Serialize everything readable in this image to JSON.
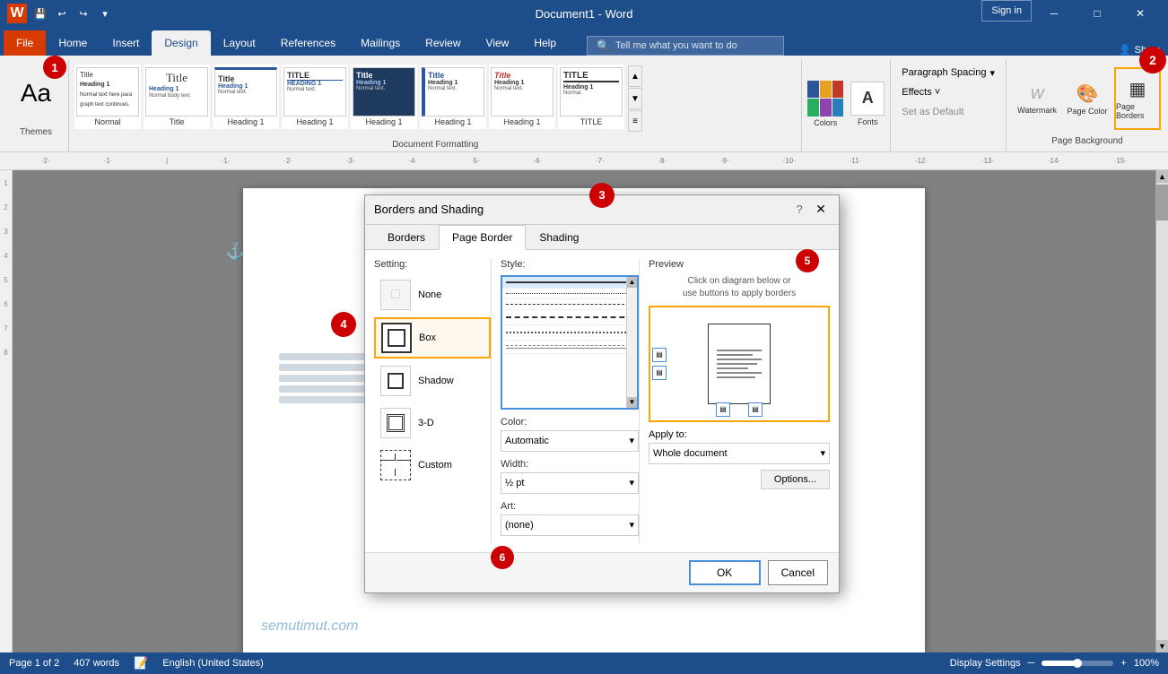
{
  "titlebar": {
    "title": "Document1 - Word",
    "save_label": "💾",
    "undo_label": "↩",
    "redo_label": "↪",
    "minimize": "─",
    "maximize": "□",
    "close": "✕",
    "signin": "Sign in"
  },
  "ribbon": {
    "tabs": [
      "File",
      "Home",
      "Insert",
      "Design",
      "Layout",
      "References",
      "Mailings",
      "Review",
      "View",
      "Help"
    ],
    "active_tab": "Design",
    "themes_label": "Themes",
    "colors_label": "Colors",
    "fonts_label": "Fonts",
    "paragraph_spacing_label": "Paragraph Spacing",
    "effects_label": "Effects ˅",
    "set_as_default_label": "Set as Default",
    "watermark_label": "Watermark",
    "page_color_label": "Page Color",
    "page_borders_label": "Page Borders",
    "page_background_label": "Page Background",
    "document_formatting_label": "Document Formatting",
    "share_label": "Share",
    "tell_me_placeholder": "Tell me what you want to do",
    "style_items": [
      {
        "label": "Normal",
        "style": "normal"
      },
      {
        "label": "Title",
        "style": "title"
      },
      {
        "label": "Heading 1",
        "style": "h1"
      },
      {
        "label": "Heading 1",
        "style": "h1b"
      },
      {
        "label": "HEADING 1",
        "style": "h1c"
      },
      {
        "label": "Heading 1",
        "style": "h1d"
      },
      {
        "label": "Heading 1",
        "style": "h1e"
      },
      {
        "label": "TITLE",
        "style": "title2"
      }
    ]
  },
  "dialog": {
    "title": "Borders and Shading",
    "tabs": [
      "Borders",
      "Page Border",
      "Shading"
    ],
    "active_tab": "Page Border",
    "setting_label": "Setting:",
    "settings": [
      {
        "id": "none",
        "label": "None"
      },
      {
        "id": "box",
        "label": "Box"
      },
      {
        "id": "shadow",
        "label": "Shadow"
      },
      {
        "id": "3d",
        "label": "3-D"
      },
      {
        "id": "custom",
        "label": "Custom"
      }
    ],
    "active_setting": "Box",
    "style_label": "Style:",
    "color_label": "Color:",
    "color_value": "Automatic",
    "width_label": "Width:",
    "width_value": "½ pt",
    "art_label": "Art:",
    "art_value": "(none)",
    "preview_label": "Preview",
    "preview_instruction": "Click on diagram below or\nuse buttons to apply borders",
    "apply_label": "Apply to:",
    "apply_value": "Whole document",
    "options_label": "Options...",
    "ok_label": "OK",
    "cancel_label": "Cancel"
  },
  "status": {
    "page_info": "Page 1 of 2",
    "words": "407 words",
    "language": "English (United States)",
    "display_settings": "Display Settings",
    "zoom": "100%",
    "zoom_minus": "─",
    "zoom_plus": "+"
  },
  "badges": {
    "b1": "1",
    "b2": "2",
    "b3": "3",
    "b4": "4",
    "b5": "5",
    "b6": "6"
  },
  "watermark": "semutimut.com"
}
